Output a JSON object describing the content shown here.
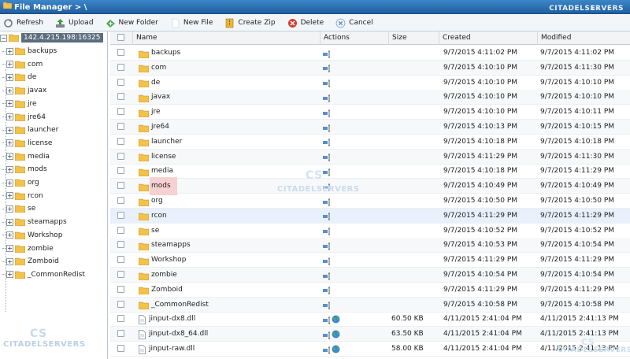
{
  "titlebar": {
    "title": "File Manager > \\",
    "brand": "CITADELSERVERS",
    "brand_mark": "CS"
  },
  "toolbar": {
    "buttons": [
      {
        "label": "Refresh",
        "icon": "refresh-icon"
      },
      {
        "label": "Upload",
        "icon": "upload-icon"
      },
      {
        "label": "New Folder",
        "icon": "new-folder-icon"
      },
      {
        "label": "New File",
        "icon": "new-file-icon"
      },
      {
        "label": "Create Zip",
        "icon": "zip-icon"
      },
      {
        "label": "Delete",
        "icon": "delete-icon"
      },
      {
        "label": "Cancel",
        "icon": "cancel-icon"
      }
    ]
  },
  "tree": {
    "root": "142.4.215.198:16325",
    "items": [
      "backups",
      "com",
      "de",
      "javax",
      "jre",
      "jre64",
      "launcher",
      "license",
      "media",
      "mods",
      "org",
      "rcon",
      "se",
      "steamapps",
      "Workshop",
      "zombie",
      "Zomboid",
      "_CommonRedist"
    ]
  },
  "grid": {
    "columns": {
      "name": "Name",
      "actions": "Actions",
      "size": "Size",
      "created": "Created",
      "modified": "Modified"
    },
    "rows": [
      {
        "name": "backups",
        "type": "folder",
        "size": "",
        "created": "9/7/2015 4:11:02 PM",
        "modified": "9/7/2015 4:11:02 PM"
      },
      {
        "name": "com",
        "type": "folder",
        "size": "",
        "created": "9/7/2015 4:10:10 PM",
        "modified": "9/7/2015 4:11:30 PM"
      },
      {
        "name": "de",
        "type": "folder",
        "size": "",
        "created": "9/7/2015 4:10:10 PM",
        "modified": "9/7/2015 4:10:10 PM"
      },
      {
        "name": "javax",
        "type": "folder",
        "size": "",
        "created": "9/7/2015 4:10:10 PM",
        "modified": "9/7/2015 4:10:10 PM"
      },
      {
        "name": "jre",
        "type": "folder",
        "size": "",
        "created": "9/7/2015 4:10:10 PM",
        "modified": "9/7/2015 4:10:11 PM"
      },
      {
        "name": "jre64",
        "type": "folder",
        "size": "",
        "created": "9/7/2015 4:10:13 PM",
        "modified": "9/7/2015 4:10:15 PM"
      },
      {
        "name": "launcher",
        "type": "folder",
        "size": "",
        "created": "9/7/2015 4:10:18 PM",
        "modified": "9/7/2015 4:10:18 PM"
      },
      {
        "name": "license",
        "type": "folder",
        "size": "",
        "created": "9/7/2015 4:11:29 PM",
        "modified": "9/7/2015 4:11:30 PM"
      },
      {
        "name": "media",
        "type": "folder",
        "size": "",
        "created": "9/7/2015 4:10:18 PM",
        "modified": "9/7/2015 4:11:29 PM"
      },
      {
        "name": "mods",
        "type": "folder",
        "size": "",
        "created": "9/7/2015 4:10:49 PM",
        "modified": "9/7/2015 4:10:49 PM",
        "highlight": true
      },
      {
        "name": "org",
        "type": "folder",
        "size": "",
        "created": "9/7/2015 4:10:50 PM",
        "modified": "9/7/2015 4:10:50 PM"
      },
      {
        "name": "rcon",
        "type": "folder",
        "size": "",
        "created": "9/7/2015 4:11:29 PM",
        "modified": "9/7/2015 4:11:29 PM",
        "selected": true
      },
      {
        "name": "se",
        "type": "folder",
        "size": "",
        "created": "9/7/2015 4:10:52 PM",
        "modified": "9/7/2015 4:10:52 PM"
      },
      {
        "name": "steamapps",
        "type": "folder",
        "size": "",
        "created": "9/7/2015 4:10:53 PM",
        "modified": "9/7/2015 4:10:54 PM"
      },
      {
        "name": "Workshop",
        "type": "folder",
        "size": "",
        "created": "9/7/2015 4:11:29 PM",
        "modified": "9/7/2015 4:11:29 PM"
      },
      {
        "name": "zombie",
        "type": "folder",
        "size": "",
        "created": "9/7/2015 4:10:54 PM",
        "modified": "9/7/2015 4:10:54 PM"
      },
      {
        "name": "Zomboid",
        "type": "folder",
        "size": "",
        "created": "9/7/2015 4:11:29 PM",
        "modified": "9/7/2015 4:11:29 PM"
      },
      {
        "name": "_CommonRedist",
        "type": "folder",
        "size": "",
        "created": "9/7/2015 4:10:58 PM",
        "modified": "9/7/2015 4:10:58 PM"
      },
      {
        "name": "jinput-dx8.dll",
        "type": "file",
        "size": "60.50 KB",
        "created": "4/11/2015 2:41:04 PM",
        "modified": "4/11/2015 2:41:13 PM"
      },
      {
        "name": "jinput-dx8_64.dll",
        "type": "file",
        "size": "63.50 KB",
        "created": "4/11/2015 2:41:04 PM",
        "modified": "4/11/2015 2:41:13 PM"
      },
      {
        "name": "jinput-raw.dll",
        "type": "file",
        "size": "58.00 KB",
        "created": "4/11/2015 2:41:04 PM",
        "modified": "4/11/2015 2:41:13 PM"
      }
    ]
  },
  "colors": {
    "titlebar": "#2b6fb0",
    "folder": "#f2c24a",
    "highlight": "#f7d1d1",
    "selected_row": "#e8f1fb",
    "tree_root_bg": "#5c6d7d"
  }
}
